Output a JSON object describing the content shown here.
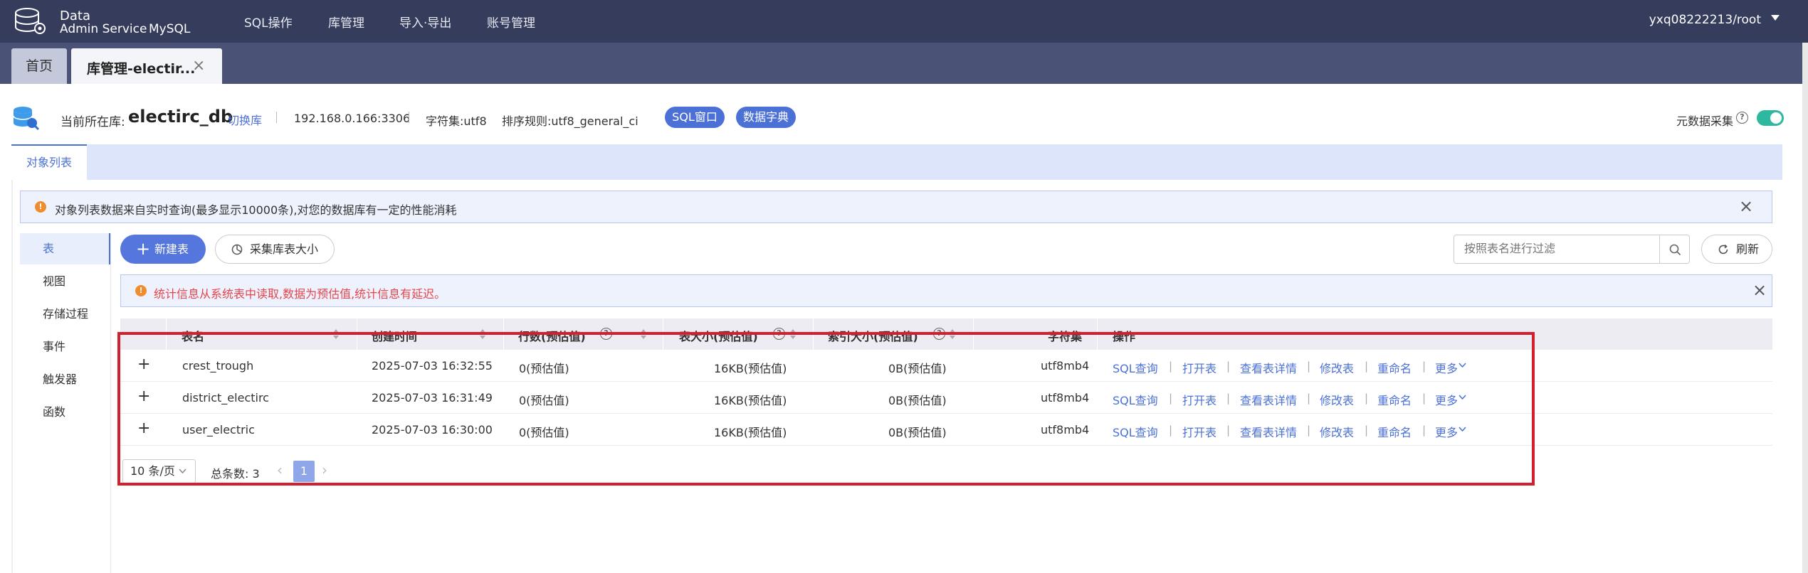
{
  "topbar": {
    "logo_line1": "Data",
    "logo_line2": "Admin Service",
    "logo_line3": "MySQL",
    "nav": [
      "SQL操作",
      "库管理",
      "导入·导出",
      "账号管理"
    ],
    "user": "yxq08222213/root"
  },
  "tabs": {
    "home": "首页",
    "active": "库管理-electir...",
    "close": "×"
  },
  "dbinfo": {
    "current_label": "当前所在库:",
    "db_name": "electirc_db",
    "switch_label": "切换库",
    "host": "192.168.0.166:3306",
    "charset": "字符集:utf8",
    "collation": "排序规则:utf8_general_ci",
    "sql_window": "SQL窗口",
    "data_dict": "数据字典",
    "metadata_label": "元数据采集",
    "metadata_enabled": true
  },
  "object_tab": "对象列表",
  "alert1": "对象列表数据来自实时查询(最多显示10000条),对您的数据库有一定的性能消耗",
  "sidemenu": [
    "表",
    "视图",
    "存储过程",
    "事件",
    "触发器",
    "函数"
  ],
  "toolbar": {
    "new_table": "新建表",
    "collect_size": "采集库表大小",
    "search_placeholder": "按照表名进行过滤",
    "refresh": "刷新"
  },
  "alert2": "统计信息从系统表中读取,数据为预估值,统计信息有延迟。",
  "table": {
    "headers": [
      "表名",
      "创建时间",
      "行数(预估值)",
      "表大小(预估值)",
      "索引大小(预估值)",
      "字符集",
      "操作"
    ],
    "rows": [
      {
        "name": "crest_trough",
        "created": "2025-07-03 16:32:55",
        "rows": "0(预估值)",
        "size": "16KB(预估值)",
        "index": "0B(预估值)",
        "charset": "utf8mb4"
      },
      {
        "name": "district_electirc",
        "created": "2025-07-03 16:31:49",
        "rows": "0(预估值)",
        "size": "16KB(预估值)",
        "index": "0B(预估值)",
        "charset": "utf8mb4"
      },
      {
        "name": "user_electric",
        "created": "2025-07-03 16:30:00",
        "rows": "0(预估值)",
        "size": "16KB(预估值)",
        "index": "0B(预估值)",
        "charset": "utf8mb4"
      }
    ],
    "actions": [
      "SQL查询",
      "打开表",
      "查看表详情",
      "修改表",
      "重命名",
      "更多"
    ]
  },
  "pager": {
    "page_size": "10 条/页",
    "total": "总条数: 3",
    "current": "1"
  },
  "colors": {
    "topbar": "#353c5c",
    "accent": "#4c71d6",
    "warning_text": "#e5454c",
    "highlight": "#d4202e"
  }
}
